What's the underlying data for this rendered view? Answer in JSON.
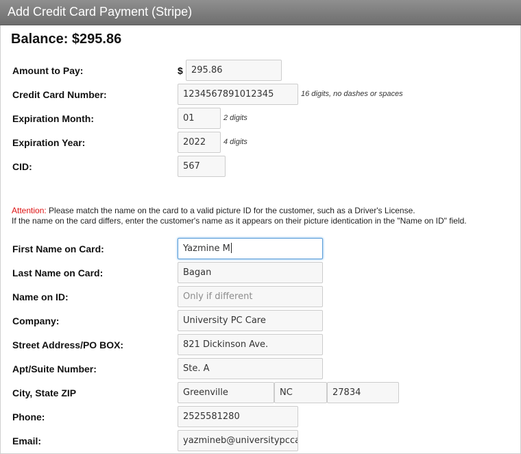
{
  "window": {
    "title": "Add Credit Card Payment (Stripe)"
  },
  "balance": {
    "text": "Balance: $295.86"
  },
  "payment": {
    "amount_label": "Amount to Pay:",
    "currency_symbol": "$",
    "amount_value": "295.86",
    "card_number_label": "Credit Card Number:",
    "card_number_value": "1234567891012345",
    "card_number_hint": "16 digits, no dashes or spaces",
    "exp_month_label": "Expiration Month:",
    "exp_month_value": "01",
    "exp_month_hint": "2 digits",
    "exp_year_label": "Expiration Year:",
    "exp_year_value": "2022",
    "exp_year_hint": "4 digits",
    "cid_label": "CID:",
    "cid_value": "567"
  },
  "attention": {
    "prefix": "Attention:",
    "line1": " Please match the name on the card to a valid picture ID for the customer, such as a Driver's License.",
    "line2": "If the name on the card differs, enter the customer's name as it appears on their picture identication in the \"Name on ID\" field."
  },
  "customer": {
    "first_name_label": "First Name on Card:",
    "first_name_value": "Yazmine M",
    "last_name_label": "Last Name on Card:",
    "last_name_value": "Bagan",
    "name_on_id_label": "Name on ID:",
    "name_on_id_placeholder": "Only if different",
    "company_label": "Company:",
    "company_value": "University PC Care",
    "street_label": "Street Address/PO BOX:",
    "street_value": "821 Dickinson Ave.",
    "apt_label": "Apt/Suite Number:",
    "apt_value": "Ste. A",
    "city_state_zip_label": "City, State ZIP",
    "city_value": "Greenville",
    "state_value": "NC",
    "zip_value": "27834",
    "phone_label": "Phone:",
    "phone_value": "2525581280",
    "email_label": "Email:",
    "email_value": "yazmineb@universitypccar"
  }
}
